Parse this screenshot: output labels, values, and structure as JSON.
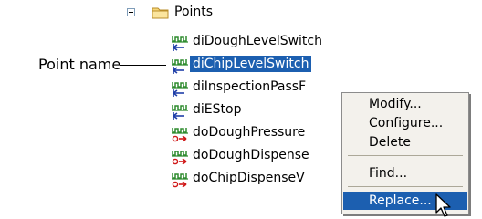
{
  "tree": {
    "root_label": "Points",
    "items": [
      {
        "label": "diDoughLevelSwitch",
        "kind": "di"
      },
      {
        "label": "diChipLevelSwitch",
        "kind": "di",
        "selected": true
      },
      {
        "label": "diInspectionPassF",
        "kind": "di"
      },
      {
        "label": "diEStop",
        "kind": "di"
      },
      {
        "label": "doDoughPressure",
        "kind": "do"
      },
      {
        "label": "doDoughDispense",
        "kind": "do"
      },
      {
        "label": "doChipDispenseV",
        "kind": "do"
      }
    ]
  },
  "annotation": {
    "text": "Point name"
  },
  "context_menu": {
    "items": [
      {
        "label": "Modify..."
      },
      {
        "label": "Configure..."
      },
      {
        "label": "Delete"
      },
      {
        "label": "Find..."
      },
      {
        "label": "Replace...",
        "highlighted": true
      }
    ]
  },
  "colors": {
    "selection": "#1c5fb0",
    "menu_bg": "#f3f1ec",
    "icon_green": "#2e8b2e",
    "icon_blue": "#1f3fa8",
    "icon_red": "#d01818"
  }
}
